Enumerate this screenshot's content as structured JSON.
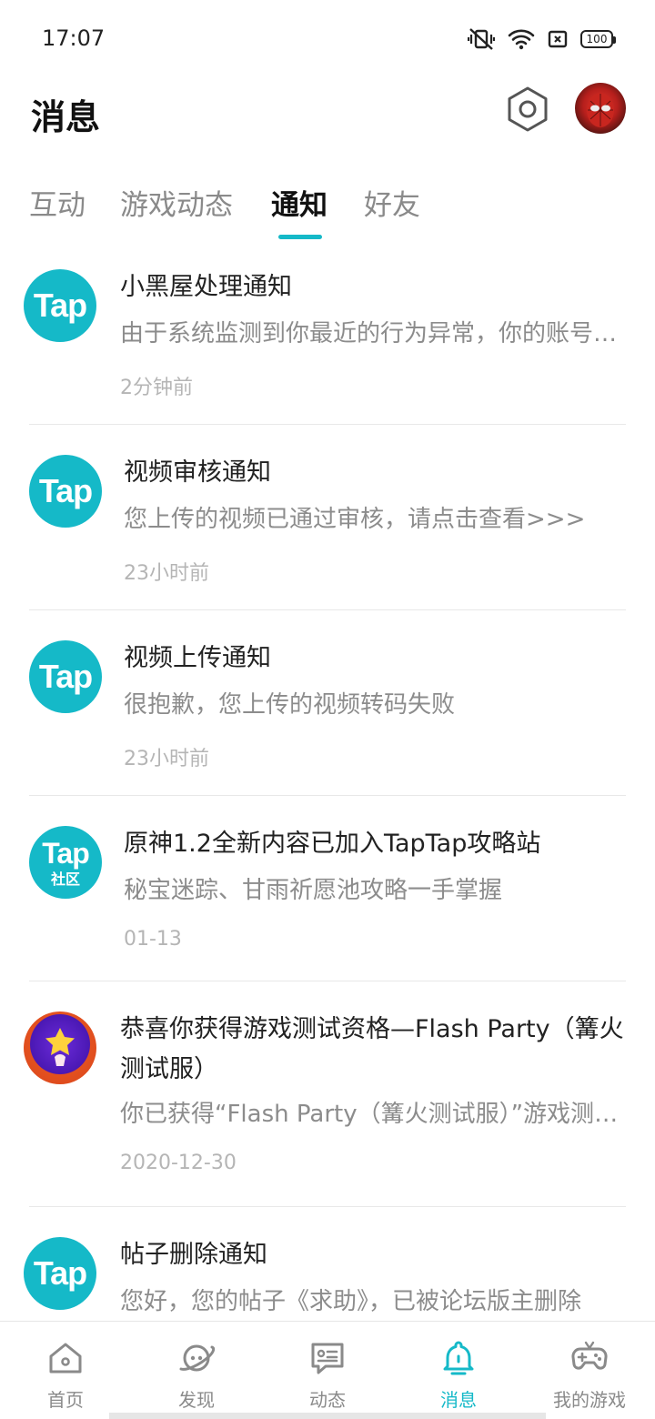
{
  "status_bar": {
    "time": "17:07",
    "battery": "100",
    "icons": [
      "vibrate-mute-icon",
      "wifi-icon",
      "sim-icon",
      "battery-icon"
    ]
  },
  "header": {
    "title": "消息",
    "settings_icon": "settings-hexagon-icon",
    "avatar_icon": "user-avatar"
  },
  "tabs": [
    {
      "label": "互动",
      "active": false
    },
    {
      "label": "游戏动态",
      "active": false
    },
    {
      "label": "通知",
      "active": true
    },
    {
      "label": "好友",
      "active": false
    }
  ],
  "accent_color": "#15b9c8",
  "notifications": [
    {
      "logo": "Tap",
      "logo_sub": "",
      "title": "小黑屋处理通知",
      "desc": "由于系统监测到你最近的行为异常，你的账号已被关进小黑屋",
      "time": "2分钟前"
    },
    {
      "logo": "Tap",
      "logo_sub": "",
      "title": "视频审核通知",
      "desc": "您上传的视频已通过审核，请点击查看>>>",
      "time": "23小时前"
    },
    {
      "logo": "Tap",
      "logo_sub": "",
      "title": "视频上传通知",
      "desc": "很抱歉，您上传的视频转码失败",
      "time": "23小时前"
    },
    {
      "logo": "Tap",
      "logo_sub": "社区",
      "title": "原神1.2全新内容已加入TapTap攻略站",
      "desc": "秘宝迷踪、甘雨祈愿池攻略一手掌握",
      "time": "01-13"
    },
    {
      "logo": "game",
      "logo_sub": "",
      "title": "恭喜你获得游戏测试资格—Flash Party（篝火测试服）",
      "desc": "你已获得“Flash Party（篝火测试服）”游戏测试资格",
      "time": "2020-12-30"
    },
    {
      "logo": "Tap",
      "logo_sub": "",
      "title": "帖子删除通知",
      "desc": "您好，您的帖子《求助》，已被论坛版主删除",
      "time": ""
    }
  ],
  "bottom_nav": [
    {
      "label": "首页",
      "icon": "home-icon",
      "active": false
    },
    {
      "label": "发现",
      "icon": "planet-icon",
      "active": false
    },
    {
      "label": "动态",
      "icon": "chat-card-icon",
      "active": false
    },
    {
      "label": "消息",
      "icon": "bell-icon",
      "active": true
    },
    {
      "label": "我的游戏",
      "icon": "gamepad-icon",
      "active": false
    }
  ]
}
